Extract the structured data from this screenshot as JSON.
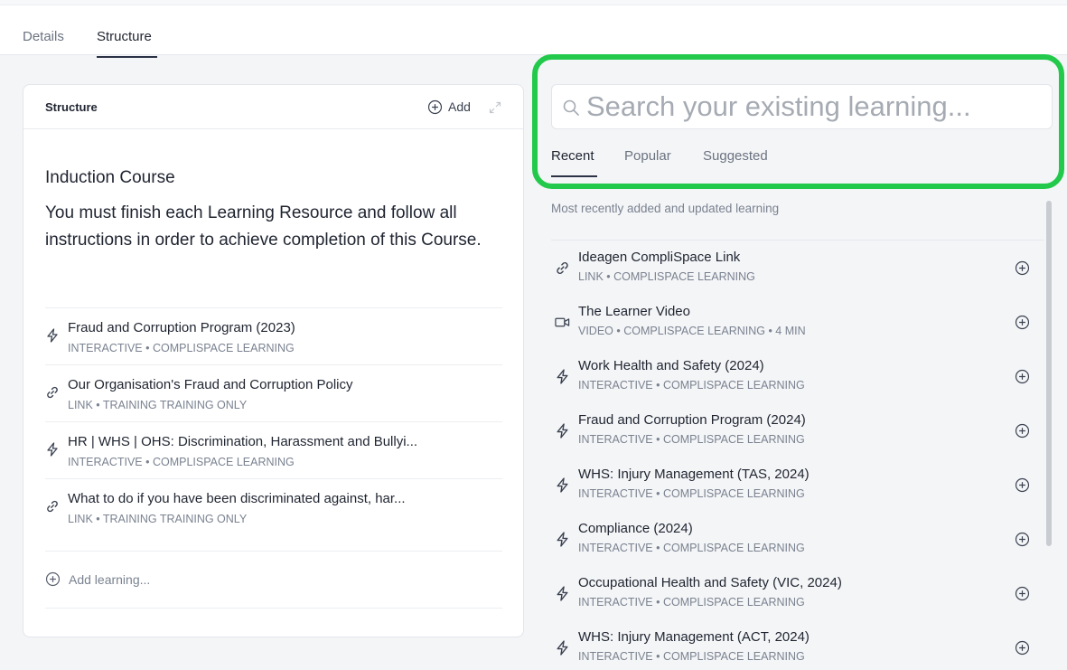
{
  "tabs": [
    {
      "label": "Details",
      "active": false
    },
    {
      "label": "Structure",
      "active": true
    }
  ],
  "structure_card": {
    "title": "Structure",
    "add_label": "Add",
    "course_title": "Induction Course",
    "course_description": "You must finish each Learning Resource and follow all instructions in order to achieve completion of this Course.",
    "items": [
      {
        "icon": "lightning-icon",
        "title": "Fraud and Corruption Program (2023)",
        "subtitle": "INTERACTIVE • COMPLISPACE LEARNING"
      },
      {
        "icon": "link-icon",
        "title": "Our Organisation's Fraud and Corruption Policy",
        "subtitle": "LINK • TRAINING TRAINING ONLY"
      },
      {
        "icon": "lightning-icon",
        "title": "HR | WHS | OHS: Discrimination, Harassment and Bullyi...",
        "subtitle": "INTERACTIVE • COMPLISPACE LEARNING"
      },
      {
        "icon": "link-icon",
        "title": "What to do if you have been discriminated against, har...",
        "subtitle": "LINK • TRAINING TRAINING ONLY"
      }
    ],
    "add_learning_label": "Add learning..."
  },
  "search": {
    "placeholder": "Search your existing learning...",
    "value": ""
  },
  "right_tabs": [
    {
      "label": "Recent",
      "active": true
    },
    {
      "label": "Popular",
      "active": false
    },
    {
      "label": "Suggested",
      "active": false
    }
  ],
  "recent_caption": "Most recently added and updated learning",
  "recent_items": [
    {
      "icon": "link-icon",
      "title": "Ideagen CompliSpace Link",
      "subtitle": "LINK • COMPLISPACE LEARNING"
    },
    {
      "icon": "video-icon",
      "title": "The Learner Video",
      "subtitle": "VIDEO • COMPLISPACE LEARNING • 4 MIN"
    },
    {
      "icon": "lightning-icon",
      "title": "Work Health and Safety (2024)",
      "subtitle": "INTERACTIVE • COMPLISPACE LEARNING"
    },
    {
      "icon": "lightning-icon",
      "title": "Fraud and Corruption Program (2024)",
      "subtitle": "INTERACTIVE • COMPLISPACE LEARNING"
    },
    {
      "icon": "lightning-icon",
      "title": "WHS: Injury Management (TAS, 2024)",
      "subtitle": "INTERACTIVE • COMPLISPACE LEARNING"
    },
    {
      "icon": "lightning-icon",
      "title": "Compliance (2024)",
      "subtitle": "INTERACTIVE • COMPLISPACE LEARNING"
    },
    {
      "icon": "lightning-icon",
      "title": "Occupational Health and Safety (VIC, 2024)",
      "subtitle": "INTERACTIVE • COMPLISPACE LEARNING"
    },
    {
      "icon": "lightning-icon",
      "title": "WHS: Injury Management (ACT, 2024)",
      "subtitle": "INTERACTIVE • COMPLISPACE LEARNING"
    }
  ],
  "colors": {
    "highlight": "#22c94b",
    "text": "#1f2430",
    "muted": "#7a8290"
  }
}
